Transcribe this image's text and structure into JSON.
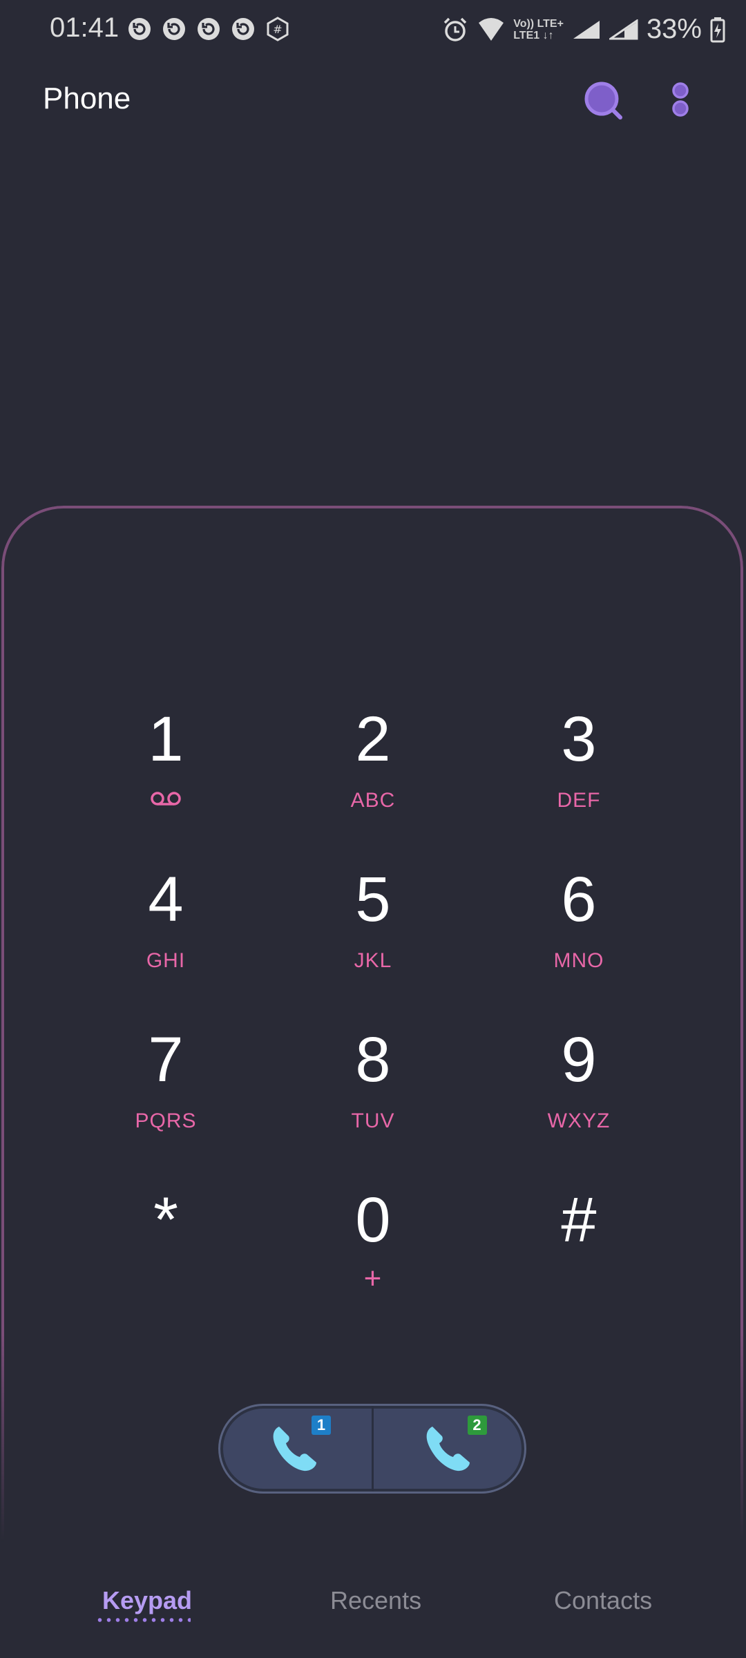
{
  "status_bar": {
    "time": "01:41",
    "network_top": "Vo)) LTE+",
    "network_bottom": "LTE1 ↓↑",
    "battery_percent": "33%"
  },
  "app_bar": {
    "title": "Phone",
    "search_icon": "search-icon",
    "more_icon": "more-vert-icon"
  },
  "keypad": {
    "keys": [
      {
        "digit": "1",
        "letters": ""
      },
      {
        "digit": "2",
        "letters": "ABC"
      },
      {
        "digit": "3",
        "letters": "DEF"
      },
      {
        "digit": "4",
        "letters": "GHI"
      },
      {
        "digit": "5",
        "letters": "JKL"
      },
      {
        "digit": "6",
        "letters": "MNO"
      },
      {
        "digit": "7",
        "letters": "PQRS"
      },
      {
        "digit": "8",
        "letters": "TUV"
      },
      {
        "digit": "9",
        "letters": "WXYZ"
      },
      {
        "digit": "*",
        "letters": ""
      },
      {
        "digit": "0",
        "letters": "+"
      },
      {
        "digit": "#",
        "letters": ""
      }
    ]
  },
  "call_buttons": [
    {
      "sim": "1",
      "badge_color": "#1e7fc8"
    },
    {
      "sim": "2",
      "badge_color": "#2e9a3c"
    }
  ],
  "bottom_nav": {
    "tabs": [
      {
        "label": "Keypad",
        "active": true
      },
      {
        "label": "Recents",
        "active": false
      },
      {
        "label": "Contacts",
        "active": false
      }
    ]
  },
  "colors": {
    "background": "#292a36",
    "accent": "#b69cf2",
    "letters": "#e867a8",
    "call_icon": "#7fdcf5"
  }
}
